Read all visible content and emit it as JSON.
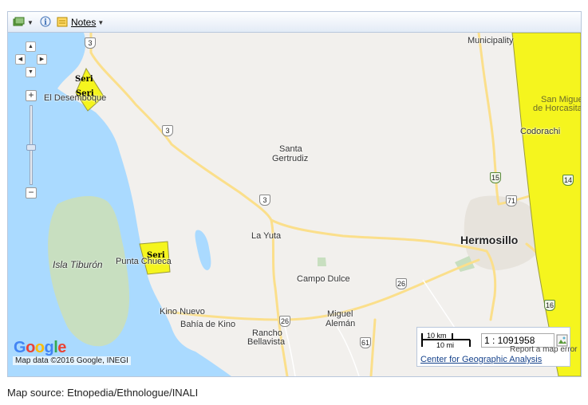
{
  "toolbar": {
    "layers_icon": "layers-icon",
    "info_icon": "info-icon",
    "notes_icon": "notes-icon",
    "notes_label": "Notes"
  },
  "map": {
    "labels": {
      "el_desemboque": "El Desemboque",
      "santa": "Santa",
      "gertrudiz": "Gertrudiz",
      "la_yuta": "La Yuta",
      "isla_tiburon": "Isla Tiburón",
      "punta_chueca": "Punta Chueca",
      "campo_dulce": "Campo Dulce",
      "hermosillo": "Hermosillo",
      "kino_nuevo": "Kino Nuevo",
      "bahia_de_kino": "Bahía de Kino",
      "miguel": "Miguel",
      "aleman": "Alemán",
      "rancho": "Rancho",
      "bellavista": "Bellavista",
      "carbo_municipality": "Municipality",
      "san_miguel": "San Miguel",
      "de_horcasitas": "de Horcasitas",
      "codorachi": "Codorachi"
    },
    "shields": [
      "3",
      "3",
      "3",
      "15",
      "71",
      "14",
      "26",
      "26",
      "16",
      "61"
    ],
    "seri_labels": [
      "Seri",
      "Seri",
      "Seri"
    ],
    "zoom_in": "+",
    "zoom_out": "−",
    "google_logo": "Google",
    "attribution": "Map data ©2016 Google, INEGI",
    "report": "Report a map error"
  },
  "scale": {
    "km": "10 km",
    "mi": "10 mi",
    "ratio": "1 : 1091958",
    "link": "Center for Geographic Analysis"
  },
  "source": "Map source: Etnopedia/Ethnologue/INALI",
  "colors": {
    "sea": "#aadaff",
    "land": "#f2f0ed",
    "island": "#c8dfc0",
    "road": "#fbdf8b",
    "polygon": "#f5f51e",
    "link": "#15428b"
  }
}
